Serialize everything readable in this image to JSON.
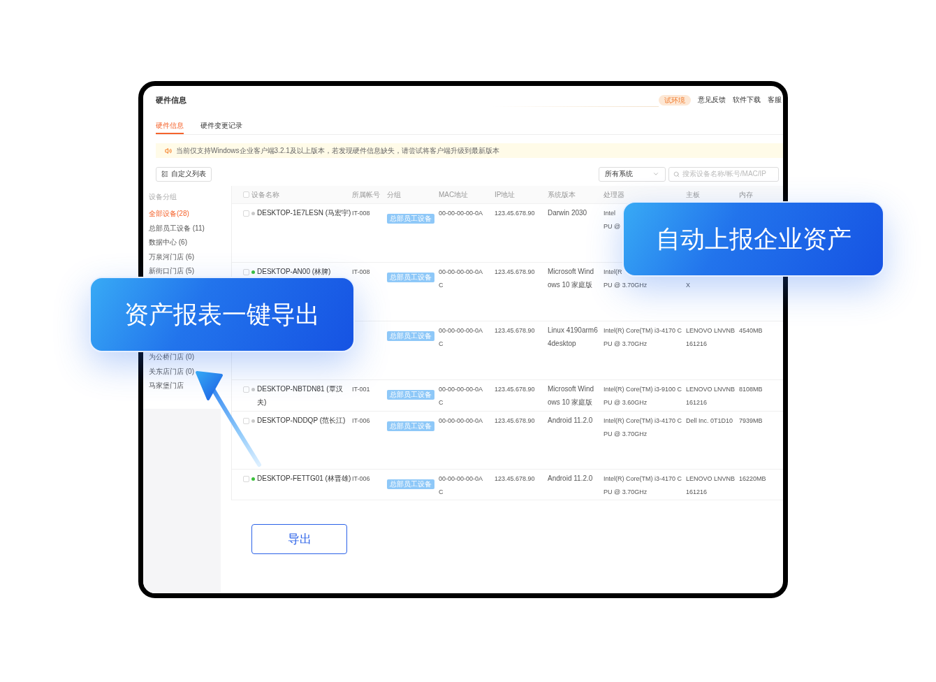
{
  "header": {
    "title": "硬件信息",
    "env_badge": "试环境",
    "links": [
      "意见反馈",
      "软件下载",
      "客服"
    ]
  },
  "tabs": [
    {
      "label": "硬件信息",
      "selected": true
    },
    {
      "label": "硬件变更记录",
      "selected": false
    }
  ],
  "notice": {
    "text": "当前仅支持Windows企业客户端3.2.1及以上版本，若发现硬件信息缺失，请尝试将客户端升级到最新版本"
  },
  "toolbar": {
    "columns_button": "自定义列表",
    "system_select": "所有系统",
    "search": {
      "placeholder": "搜索设备名称/帐号/MAC/IP"
    }
  },
  "sidebar": {
    "heading": "设备分组",
    "items": [
      {
        "label": "全部设备(28)",
        "selected": true
      },
      {
        "label": "总部员工设备 (11)",
        "selected": false
      },
      {
        "label": "数据中心 (6)",
        "selected": false
      },
      {
        "label": "万泉河门店 (6)",
        "selected": false
      },
      {
        "label": "新街口门店 (5)",
        "selected": false
      },
      {
        "label": "为公桥门店 (0)",
        "selected": false
      },
      {
        "label": "关东店门店 (0)",
        "selected": false
      },
      {
        "label": "马家堡门店",
        "selected": false
      }
    ]
  },
  "table": {
    "select_all_checked": false,
    "columns": [
      "设备名称",
      "所属帐号",
      "分组",
      "MAC地址",
      "IP地址",
      "系统版本",
      "处理器",
      "主板",
      "内存"
    ],
    "rows": [
      {
        "checked": false,
        "color": "#c8c8c8",
        "name": [
          "DESKTOP-1E7LESN (马宏宇)"
        ],
        "account": "IT-008",
        "group": "总部员工设备",
        "mac": [
          "00-00-00-00-0A"
        ],
        "ip": "123.45.678.90",
        "os": [
          "Darwin 2030"
        ],
        "cpu": [
          "Intel",
          "PU @"
        ]
      },
      {
        "checked": false,
        "color": "#3cc13c",
        "name": [
          "DESKTOP-AN00 (林脾)"
        ],
        "account": "IT-008",
        "group": "总部员工设备",
        "mac": [
          "00-00-00-00-0A",
          "C"
        ],
        "ip": "123.45.678.90",
        "os": [
          "Microsoft Wind",
          "ows 10 家庭版"
        ],
        "cpu": [
          "Intel(R",
          "PU @ 3.70GHz"
        ],
        "board_line_2": "X"
      },
      {
        "group": "总部员工设备",
        "mac": [
          "00-00-00-00-0A",
          "C"
        ],
        "ip": "123.45.678.90",
        "os": [
          "Linux 4190arm6",
          "4desktop"
        ],
        "cpu": [
          "Intel(R) Core(TM) i3-4170 C",
          "PU @ 3.70GHz"
        ],
        "board": [
          "LENOVO LNVNB",
          "161216"
        ],
        "memory": "4540MB"
      },
      {
        "checked": false,
        "color": "#c8c8c8",
        "name": [
          "DESKTOP-NBTDN81 (覃汉",
          "夫)"
        ],
        "account": "IT-001",
        "group": "总部员工设备",
        "mac": [
          "00-00-00-00-0A",
          "C"
        ],
        "ip": "123.45.678.90",
        "os": [
          "Microsoft Wind",
          "ows 10 家庭版"
        ],
        "cpu": [
          "Intel(R) Core(TM) i3-9100 C",
          "PU @ 3.60GHz"
        ],
        "board": [
          "LENOVO LNVNB",
          "161216"
        ],
        "memory": "8108MB"
      },
      {
        "checked": false,
        "color": "#c8c8c8",
        "name": [
          "DESKTOP-NDDQP (范长江)"
        ],
        "account": "IT-006",
        "group": "总部员工设备",
        "mac": [
          "00-00-00-00-0A"
        ],
        "ip": "123.45.678.90",
        "os": [
          "Android 11.2.0"
        ],
        "cpu": [
          "Intel(R) Core(TM) i3-4170 C",
          "PU @ 3.70GHz"
        ],
        "board": [
          "Dell Inc. 0T1D10"
        ],
        "memory": "7939MB"
      },
      {
        "checked": false,
        "color": "#3cc13c",
        "name": [
          "DESKTOP-FETTG01 (林晋雄)"
        ],
        "account": "IT-006",
        "group": "总部员工设备",
        "mac": [
          "00-00-00-00-0A",
          "C"
        ],
        "ip": "123.45.678.90",
        "os": [
          "Android 11.2.0"
        ],
        "cpu": [
          "Intel(R) Core(TM) i3-4170 C",
          "PU @ 3.70GHz"
        ],
        "board": [
          "LENOVO LNVNB",
          "161216"
        ],
        "memory": "16220MB"
      }
    ]
  },
  "callouts": [
    "自动上报企业资产",
    "资产报表一键导出"
  ],
  "export_button": "导出"
}
